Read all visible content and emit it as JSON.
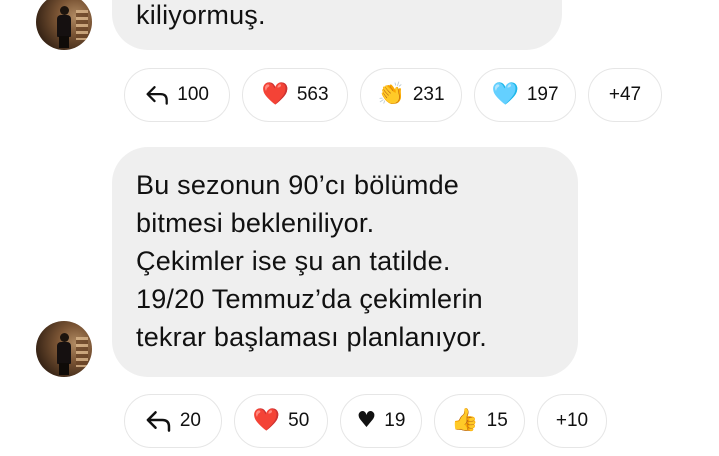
{
  "messages": [
    {
      "text": "kiliyormuş.",
      "reactions": {
        "reply_count": "100",
        "items": [
          {
            "icon": "red-heart-icon",
            "emoji": "❤️",
            "count": "563"
          },
          {
            "icon": "clapping-hands-icon",
            "emoji": "👏",
            "count": "231"
          },
          {
            "icon": "light-blue-heart-icon",
            "emoji": "🩵",
            "count": "197"
          }
        ],
        "more": "+47"
      }
    },
    {
      "text": "Bu sezonun 90’cı bölümde\nbitmesi bekleniliyor.\nÇekimler ise şu an tatilde.\n19/20 Temmuz’da çekimlerin\ntekrar başlaması planlanıyor.",
      "reactions": {
        "reply_count": "20",
        "items": [
          {
            "icon": "red-heart-icon",
            "emoji": "❤️",
            "count": "50"
          },
          {
            "icon": "black-heart-icon",
            "emoji": "♥",
            "count": "19"
          },
          {
            "icon": "thumbs-up-icon",
            "emoji": "👍",
            "count": "15"
          }
        ],
        "more": "+10"
      }
    }
  ],
  "colors": {
    "bubble": "#efefef",
    "pill_border": "#e6e6e6",
    "text": "#111111"
  }
}
